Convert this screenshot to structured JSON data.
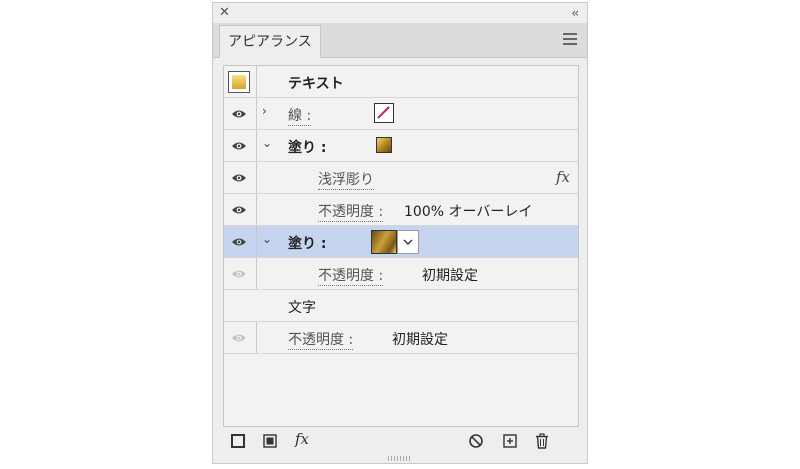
{
  "panel": {
    "close_glyph": "✕",
    "collapse_glyph": "‹‹",
    "tab_label": "アピアランス",
    "menu_icon": "hamburger-menu-icon"
  },
  "header_row": {
    "title": "テキスト"
  },
  "rows": [
    {
      "label": "線 :",
      "expanded": false
    },
    {
      "label": "塗り :",
      "expanded": true
    },
    {
      "label": "浅浮彫り",
      "fx": "fx"
    },
    {
      "label": "不透明度 :",
      "value": "100% オーバーレイ"
    },
    {
      "label": "塗り :",
      "expanded": true,
      "selected": true
    },
    {
      "label": "不透明度 :",
      "value": "初期設定"
    },
    {
      "label": "文字"
    },
    {
      "label": "不透明度 :",
      "value": "初期設定"
    }
  ],
  "footer": {
    "fx_label": "fx"
  },
  "colors": {
    "selection": "#c6d4ef",
    "gold_light": "#f2d56a",
    "gold_dark": "#7a5512",
    "stroke_red": "#d0203a"
  }
}
